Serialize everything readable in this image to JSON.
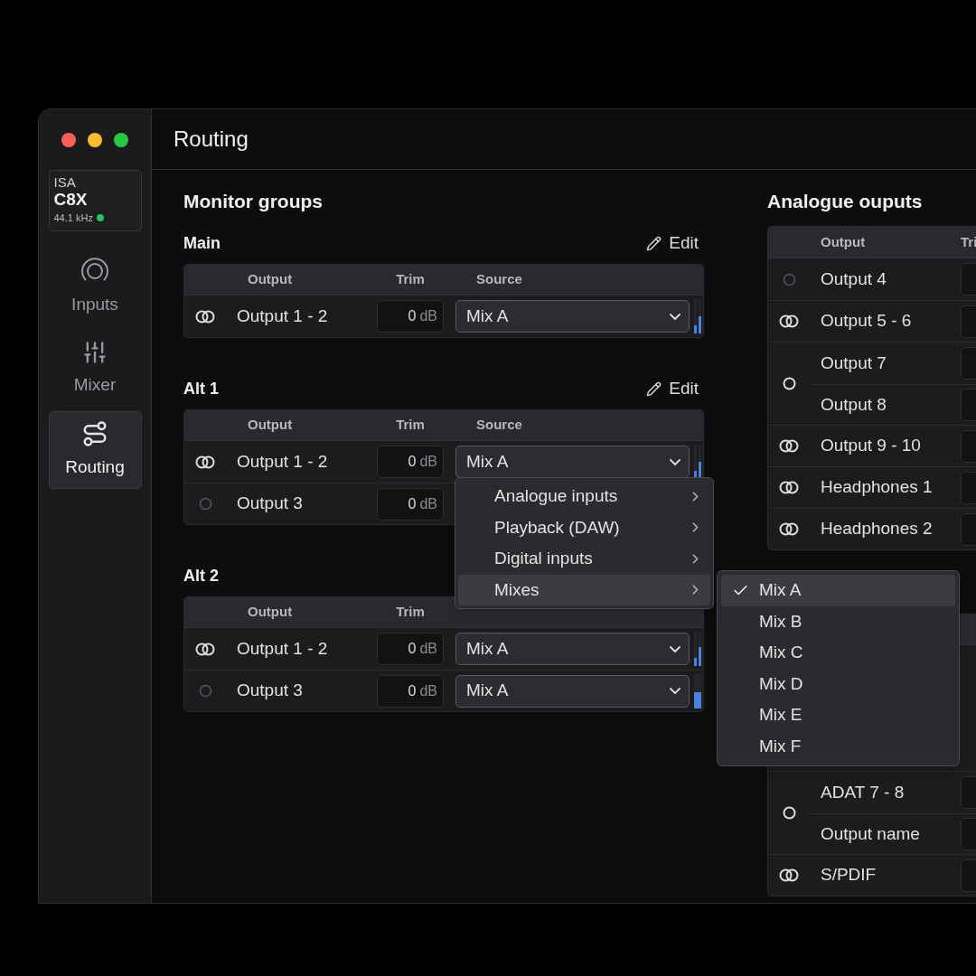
{
  "window": {
    "title": "Routing"
  },
  "device": {
    "brand": "ISA",
    "model": "C8X",
    "sample_rate": "44.1 kHz"
  },
  "sidebar": {
    "items": [
      {
        "kind": "inputs",
        "label": "Inputs",
        "selected": false
      },
      {
        "kind": "mixer",
        "label": "Mixer",
        "selected": false
      },
      {
        "kind": "routing",
        "label": "Routing",
        "selected": true
      }
    ]
  },
  "monitor_groups": {
    "title": "Monitor groups",
    "groups": [
      {
        "name": "Main",
        "edit_label": "Edit",
        "columns": [
          "Output",
          "Trim",
          "Source"
        ],
        "rows": [
          {
            "kind": "stereo",
            "name": "Output 1 - 2",
            "trim": "0",
            "trim_unit": "dB",
            "source": "Mix A",
            "meters": [
              {
                "level": 0.25
              },
              {
                "level": 0.5
              }
            ]
          }
        ]
      },
      {
        "name": "Alt 1",
        "edit_label": "Edit",
        "columns": [
          "Output",
          "Trim",
          "Source"
        ],
        "rows": [
          {
            "kind": "stereo",
            "name": "Output 1 - 2",
            "trim": "0",
            "trim_unit": "dB",
            "source": "Mix A",
            "meters": [
              {
                "level": 0.25
              },
              {
                "level": 0.5
              }
            ]
          },
          {
            "kind": "mono",
            "name": "Output 3",
            "trim": "0",
            "trim_unit": "dB"
          }
        ]
      },
      {
        "name": "Alt 2",
        "columns": [
          "Output",
          "Trim"
        ],
        "rows": [
          {
            "kind": "stereo",
            "name": "Output 1 - 2",
            "trim": "0",
            "trim_unit": "dB",
            "source": "Mix A",
            "meters": [
              {
                "level": 0.25
              },
              {
                "level": 0.55
              }
            ]
          },
          {
            "kind": "mono",
            "name": "Output 3",
            "trim": "0",
            "trim_unit": "dB",
            "source": "Mix A",
            "meters": [
              {
                "level": 0.45
              }
            ]
          }
        ]
      }
    ]
  },
  "analogue_outputs": {
    "title": "Analogue ouputs",
    "columns": [
      "Output",
      "Tri"
    ],
    "rows": [
      {
        "kind": "mono",
        "names": [
          "Output 4"
        ]
      },
      {
        "kind": "stereo",
        "names": [
          "Output 5 - 6"
        ]
      },
      {
        "kind": "pair",
        "names": [
          "Output 7",
          "Output 8"
        ]
      },
      {
        "kind": "stereo",
        "names": [
          "Output 9 - 10"
        ]
      },
      {
        "kind": "stereo",
        "names": [
          "Headphones 1"
        ]
      },
      {
        "kind": "stereo",
        "names": [
          "Headphones 2"
        ]
      }
    ]
  },
  "more_outputs": {
    "rows": [
      {
        "kind": "pair",
        "names": [
          "ADAT 7 - 8",
          "Output name"
        ]
      },
      {
        "kind": "stereo",
        "names": [
          "S/PDIF"
        ]
      }
    ]
  },
  "source_menu": {
    "items": [
      {
        "label": "Analogue inputs",
        "selected": false
      },
      {
        "label": "Playback (DAW)",
        "selected": false
      },
      {
        "label": "Digital inputs",
        "selected": false
      },
      {
        "label": "Mixes",
        "selected": true
      }
    ],
    "submenu": {
      "items": [
        {
          "label": "Mix A",
          "selected": true
        },
        {
          "label": "Mix B",
          "selected": false
        },
        {
          "label": "Mix C",
          "selected": false
        },
        {
          "label": "Mix D",
          "selected": false
        },
        {
          "label": "Mix E",
          "selected": false
        },
        {
          "label": "Mix F",
          "selected": false
        }
      ]
    }
  }
}
